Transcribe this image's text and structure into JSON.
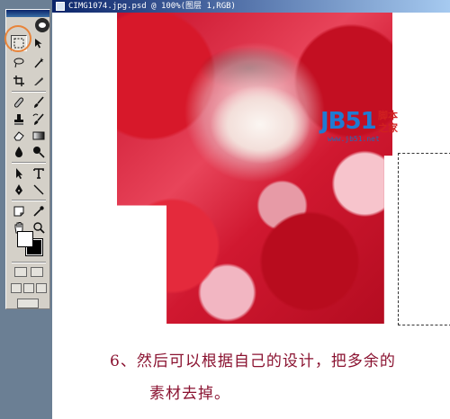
{
  "document": {
    "title": "CIMG1074.jpg.psd @ 100%(图层 1,RGB)"
  },
  "watermark": {
    "brand": "JB51",
    "cn_top": "脚本",
    "cn_bottom": "之家",
    "url": "www.jb51.net"
  },
  "caption": {
    "line1": "6、然后可以根据自己的设计，把多余的",
    "line2": "素材去掉。"
  },
  "tools": [
    {
      "name": "marquee-tool",
      "icon": "marquee-icon",
      "active": true
    },
    {
      "name": "move-tool",
      "icon": "move-icon"
    },
    {
      "name": "lasso-tool",
      "icon": "lasso-icon"
    },
    {
      "name": "magic-wand-tool",
      "icon": "magic-wand-icon"
    },
    {
      "name": "crop-tool",
      "icon": "crop-icon"
    },
    {
      "name": "slice-tool",
      "icon": "slice-icon"
    },
    {
      "name": "healing-brush-tool",
      "icon": "bandage-icon"
    },
    {
      "name": "brush-tool",
      "icon": "brush-icon"
    },
    {
      "name": "clone-stamp-tool",
      "icon": "stamp-icon"
    },
    {
      "name": "history-brush-tool",
      "icon": "history-brush-icon"
    },
    {
      "name": "eraser-tool",
      "icon": "eraser-icon"
    },
    {
      "name": "gradient-tool",
      "icon": "gradient-icon"
    },
    {
      "name": "blur-tool",
      "icon": "drop-icon"
    },
    {
      "name": "dodge-tool",
      "icon": "dodge-icon"
    },
    {
      "name": "path-select-tool",
      "icon": "arrow-icon"
    },
    {
      "name": "type-tool",
      "icon": "type-icon"
    },
    {
      "name": "pen-tool",
      "icon": "pen-icon"
    },
    {
      "name": "line-tool",
      "icon": "line-icon"
    },
    {
      "name": "notes-tool",
      "icon": "notes-icon"
    },
    {
      "name": "eyedropper-tool",
      "icon": "eyedropper-icon"
    },
    {
      "name": "hand-tool",
      "icon": "hand-icon"
    },
    {
      "name": "zoom-tool",
      "icon": "zoom-icon"
    }
  ],
  "colors": {
    "foreground": "#ffffff",
    "background": "#000000",
    "highlight": "#e8843a",
    "caption": "#8a1230"
  }
}
